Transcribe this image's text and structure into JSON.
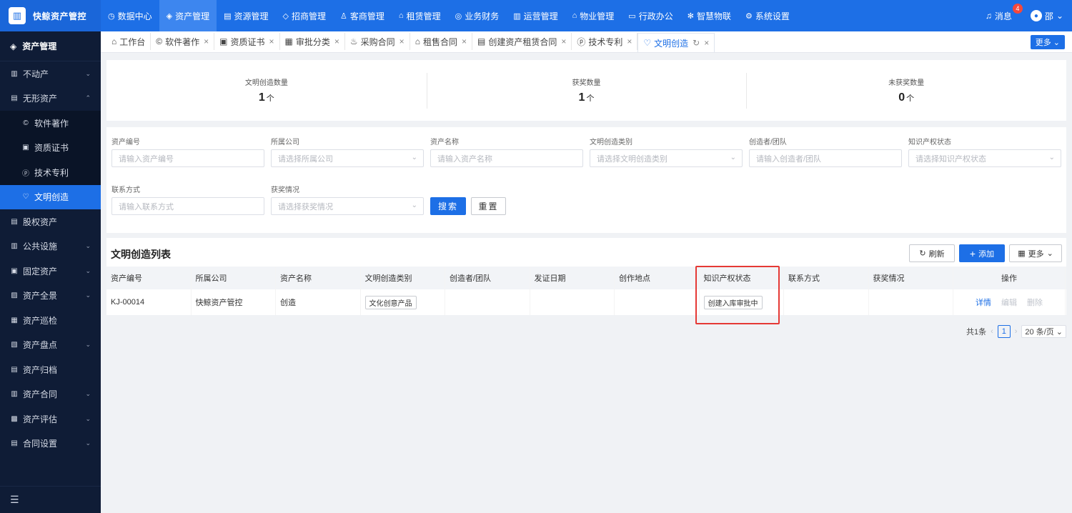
{
  "brand": {
    "name": "快鲸资产管控",
    "logo_icon": "building-icon"
  },
  "topnav": [
    {
      "label": "数据中心",
      "icon": "◷",
      "active": false
    },
    {
      "label": "资产管理",
      "icon": "◈",
      "active": true
    },
    {
      "label": "资源管理",
      "icon": "▤",
      "active": false
    },
    {
      "label": "招商管理",
      "icon": "◇",
      "active": false
    },
    {
      "label": "客商管理",
      "icon": "♙",
      "active": false
    },
    {
      "label": "租赁管理",
      "icon": "⌂",
      "active": false
    },
    {
      "label": "业务财务",
      "icon": "◎",
      "active": false
    },
    {
      "label": "运营管理",
      "icon": "▥",
      "active": false
    },
    {
      "label": "物业管理",
      "icon": "⌂",
      "active": false
    },
    {
      "label": "行政办公",
      "icon": "▭",
      "active": false
    },
    {
      "label": "智慧物联",
      "icon": "✻",
      "active": false
    },
    {
      "label": "系统设置",
      "icon": "⚙",
      "active": false
    }
  ],
  "topright": {
    "messages_label": "消息",
    "messages_count": "4",
    "user_name": "邵"
  },
  "sidebar": {
    "header": "资产管理",
    "items_top": [
      {
        "label": "不动产",
        "icon": "▥",
        "arrow": "⌄"
      },
      {
        "label": "无形资产",
        "icon": "▤",
        "arrow": "⌃"
      }
    ],
    "sub_items": [
      {
        "label": "软件著作",
        "icon": "©",
        "active": false
      },
      {
        "label": "资质证书",
        "icon": "▣",
        "active": false
      },
      {
        "label": "技术专利",
        "icon": "ⓟ",
        "active": false
      },
      {
        "label": "文明创造",
        "icon": "♡",
        "active": true
      }
    ],
    "items_bottom": [
      {
        "label": "股权资产",
        "icon": "▤",
        "arrow": ""
      },
      {
        "label": "公共设施",
        "icon": "▥",
        "arrow": "⌄"
      },
      {
        "label": "固定资产",
        "icon": "▣",
        "arrow": "⌄"
      },
      {
        "label": "资产全景",
        "icon": "▨",
        "arrow": "⌄"
      },
      {
        "label": "资产巡检",
        "icon": "▦",
        "arrow": ""
      },
      {
        "label": "资产盘点",
        "icon": "▧",
        "arrow": "⌄"
      },
      {
        "label": "资产归档",
        "icon": "▤",
        "arrow": ""
      },
      {
        "label": "资产合同",
        "icon": "▥",
        "arrow": "⌄"
      },
      {
        "label": "资产评估",
        "icon": "▩",
        "arrow": "⌄"
      },
      {
        "label": "合同设置",
        "icon": "▤",
        "arrow": "⌄"
      }
    ],
    "collapse_icon": "☰"
  },
  "tabs": [
    {
      "label": "工作台",
      "icon": "⌂",
      "closable": false,
      "active": false
    },
    {
      "label": "软件著作",
      "icon": "©",
      "closable": true,
      "active": false
    },
    {
      "label": "资质证书",
      "icon": "▣",
      "closable": true,
      "active": false
    },
    {
      "label": "审批分类",
      "icon": "▦",
      "closable": true,
      "active": false
    },
    {
      "label": "采购合同",
      "icon": "♨",
      "closable": true,
      "active": false
    },
    {
      "label": "租售合同",
      "icon": "⌂",
      "closable": true,
      "active": false
    },
    {
      "label": "创建资产租赁合同",
      "icon": "▤",
      "closable": true,
      "active": false
    },
    {
      "label": "技术专利",
      "icon": "ⓟ",
      "closable": true,
      "active": false
    },
    {
      "label": "文明创造",
      "icon": "♡",
      "closable": true,
      "active": true
    }
  ],
  "tabs_more": "更多",
  "stats": [
    {
      "label": "文明创造数量",
      "value": "1",
      "unit": "个"
    },
    {
      "label": "获奖数量",
      "value": "1",
      "unit": "个"
    },
    {
      "label": "未获奖数量",
      "value": "0",
      "unit": "个"
    }
  ],
  "filter": {
    "asset_no": {
      "label": "资产编号",
      "placeholder": "请输入资产编号"
    },
    "company": {
      "label": "所属公司",
      "placeholder": "请选择所属公司"
    },
    "asset_name": {
      "label": "资产名称",
      "placeholder": "请输入资产名称"
    },
    "category": {
      "label": "文明创造类别",
      "placeholder": "请选择文明创造类别"
    },
    "creator": {
      "label": "创造者/团队",
      "placeholder": "请输入创造者/团队"
    },
    "ip_status": {
      "label": "知识产权状态",
      "placeholder": "请选择知识产权状态"
    },
    "contact": {
      "label": "联系方式",
      "placeholder": "请输入联系方式"
    },
    "award": {
      "label": "获奖情况",
      "placeholder": "请选择获奖情况"
    },
    "search_label": "搜索",
    "reset_label": "重置"
  },
  "list": {
    "title": "文明创造列表",
    "refresh_label": "刷新",
    "add_label": "添加",
    "more_label": "更多",
    "columns": [
      "资产编号",
      "所属公司",
      "资产名称",
      "文明创造类别",
      "创造者/团队",
      "发证日期",
      "创作地点",
      "知识产权状态",
      "联系方式",
      "获奖情况",
      "操作"
    ],
    "rows": [
      {
        "asset_no": "KJ-00014",
        "company": "快鲸资产管控",
        "name": "创造",
        "category": "文化创意产品",
        "creator": "",
        "issue_date": "",
        "location": "",
        "ip_status": "创建入库审批中",
        "contact": "",
        "award": "",
        "ops": {
          "detail": "详情",
          "edit": "编辑",
          "delete": "删除"
        }
      }
    ]
  },
  "pager": {
    "total": "共1条",
    "current": "1",
    "page_size": "20 条/页"
  }
}
